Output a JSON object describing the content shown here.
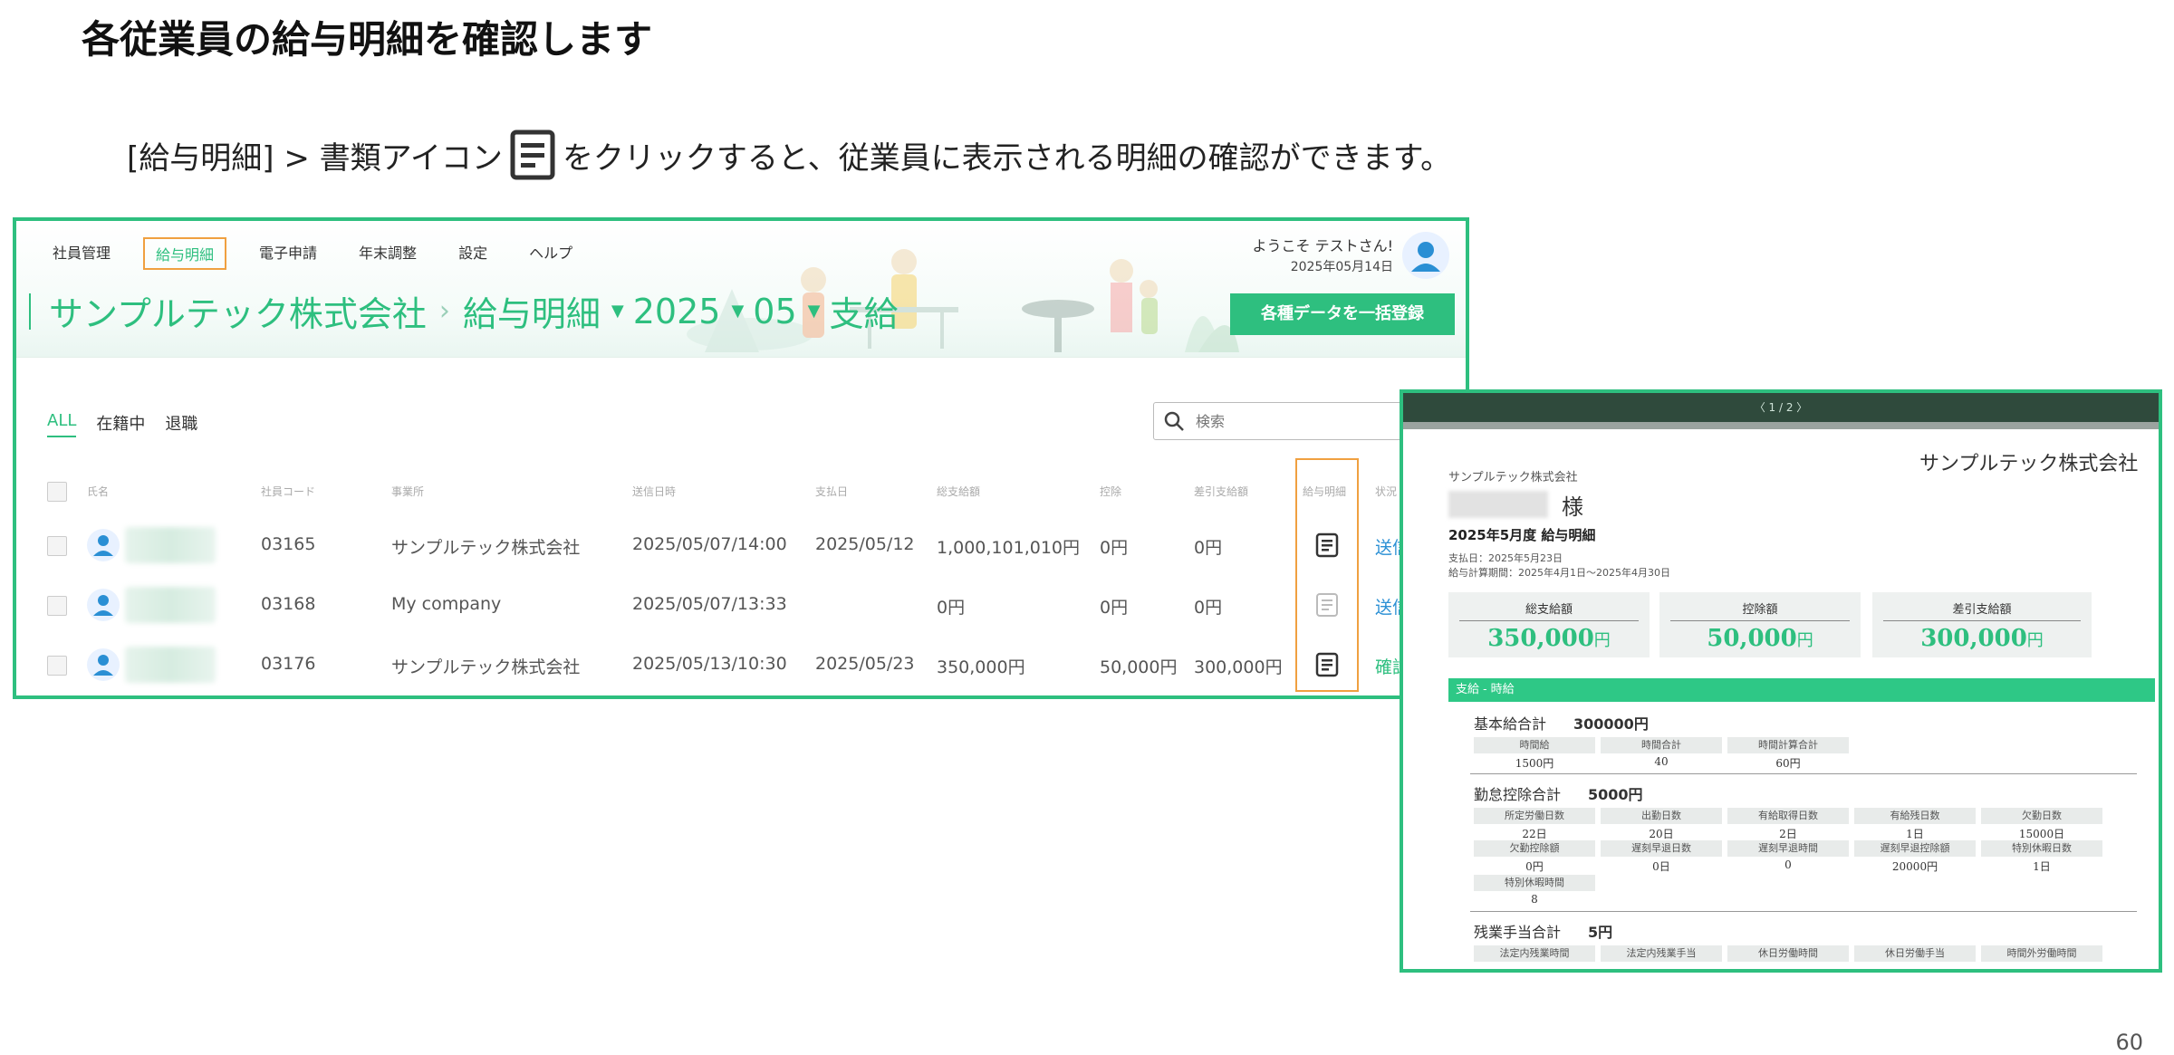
{
  "slide": {
    "title": "各従業員の給与明細を確認します",
    "instruction_pre": "[給与明細] > 書類アイコン",
    "instruction_post": "をクリックすると、従業員に表示される明細の確認ができます。",
    "page_number": "60"
  },
  "app": {
    "nav": [
      "社員管理",
      "給与明細",
      "電子申請",
      "年末調整",
      "設定",
      "ヘルプ"
    ],
    "welcome": "ようこそ テストさん!",
    "date": "2025年05月14日",
    "breadcrumb": {
      "company": "サンプルテック株式会社",
      "section": "給与明細",
      "year": "2025",
      "month": "05",
      "type": "支給"
    },
    "bulk_button": "各種データを一括登録",
    "tabs": [
      "ALL",
      "在籍中",
      "退職"
    ],
    "search_placeholder": "検索",
    "columns": [
      "氏名",
      "社員コード",
      "事業所",
      "送信日時",
      "支払日",
      "総支給額",
      "控除",
      "差引支給額",
      "給与明細",
      "状況"
    ],
    "rows": [
      {
        "code": "03165",
        "office": "サンプルテック株式会社",
        "sent": "2025/05/07/14:00",
        "paydate": "2025/05/12",
        "gross": "1,000,101,010円",
        "deduction": "0円",
        "net": "0円",
        "status": "送信"
      },
      {
        "code": "03168",
        "office": "My company",
        "sent": "2025/05/07/13:33",
        "paydate": "",
        "gross": "0円",
        "deduction": "0円",
        "net": "0円",
        "status": "送信"
      },
      {
        "code": "03176",
        "office": "サンプルテック株式会社",
        "sent": "2025/05/13/10:30",
        "paydate": "2025/05/23",
        "gross": "350,000円",
        "deduction": "50,000円",
        "net": "300,000円",
        "status": "確認"
      }
    ]
  },
  "payslip": {
    "pager": "〈 1 / 2 〉",
    "company_right": "サンプルテック株式会社",
    "company_left": "サンプルテック株式会社",
    "honorific": "様",
    "title": "2025年5月度 給与明細",
    "pay_date": "支払日：2025年5月23日",
    "period": "給与計算期間：2025年4月1日〜2025年4月30日",
    "summary": [
      {
        "label": "総支給額",
        "value": "350,000",
        "unit": "円"
      },
      {
        "label": "控除額",
        "value": "50,000",
        "unit": "円"
      },
      {
        "label": "差引支給額",
        "value": "300,000",
        "unit": "円"
      }
    ],
    "section": "支給 - 時給",
    "groups": {
      "base": {
        "title": "基本給合計",
        "value": "300000円",
        "labels": [
          "時間給",
          "時間合計",
          "時間計算合計"
        ],
        "values": [
          "1500円",
          "40",
          "60円"
        ]
      },
      "absence": {
        "title": "勤怠控除合計",
        "value": "5000円",
        "labels1": [
          "所定労働日数",
          "出勤日数",
          "有給取得日数",
          "有給残日数",
          "欠勤日数"
        ],
        "values1": [
          "22日",
          "20日",
          "2日",
          "1日",
          "15000日"
        ],
        "labels2": [
          "欠勤控除額",
          "遅刻早退日数",
          "遅刻早退時間",
          "遅刻早退控除額",
          "特別休暇日数"
        ],
        "values2": [
          "0円",
          "0日",
          "0",
          "20000円",
          "1日"
        ],
        "labels3": [
          "特別休暇時間"
        ],
        "values3": [
          "8"
        ]
      },
      "overtime": {
        "title": "残業手当合計",
        "value": "5円",
        "labels": [
          "法定内残業時間",
          "法定内残業手当",
          "休日労働時間",
          "休日労働手当",
          "時間外労働時間"
        ]
      }
    }
  }
}
